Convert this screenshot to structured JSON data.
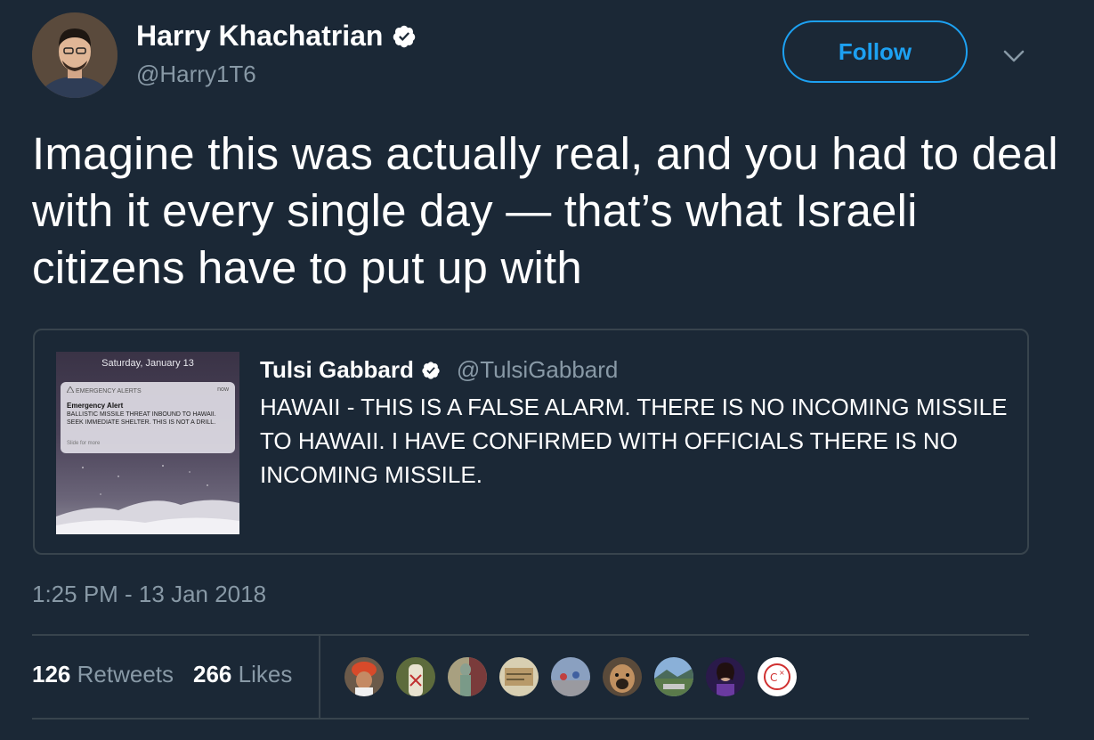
{
  "author": {
    "name": "Harry Khachatrian",
    "handle": "@Harry1T6"
  },
  "follow_label": "Follow",
  "tweet_text": "Imagine this was actually real, and you had to deal with it every single day — that’s what Israeli citizens have to put up with",
  "quoted": {
    "name": "Tulsi Gabbard",
    "handle": "@TulsiGabbard",
    "text": "HAWAII - THIS IS A FALSE ALARM. THERE IS NO INCOMING MISSILE TO HAWAII. I HAVE CONFIRMED WITH OFFICIALS THERE IS NO INCOMING MISSILE.",
    "image": {
      "date": "Saturday, January 13",
      "alert_source": "EMERGENCY ALERTS",
      "alert_time": "now",
      "alert_title": "Emergency Alert",
      "alert_body": "BALLISTIC MISSILE THREAT INBOUND TO HAWAII. SEEK IMMEDIATE SHELTER. THIS IS NOT A DRILL.",
      "alert_hint": "Slide for more"
    }
  },
  "timestamp": "1:25 PM - 13 Jan 2018",
  "stats": {
    "retweets_count": "126",
    "retweets_label": "Retweets",
    "likes_count": "266",
    "likes_label": "Likes"
  },
  "colors": {
    "background": "#1b2836",
    "accent": "#1da1f2",
    "secondary_text": "#8899a6",
    "border": "#38444d"
  },
  "icons": [
    "verified-badge-icon",
    "chevron-down-icon",
    "warning-icon"
  ]
}
